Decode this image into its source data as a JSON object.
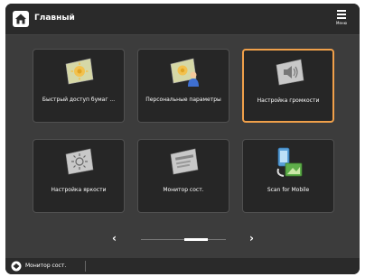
{
  "header": {
    "title": "Главный",
    "menu_label": "Меню"
  },
  "tiles": [
    {
      "label": "Быстрый доступ бумаг ...",
      "icon": "settings-sheet-icon"
    },
    {
      "label": "Персональные параметры",
      "icon": "personal-settings-icon"
    },
    {
      "label": "Настройка громкости",
      "icon": "volume-icon",
      "selected": true
    },
    {
      "label": "Настройка яркости",
      "icon": "brightness-icon"
    },
    {
      "label": "Монитор сост.",
      "icon": "status-monitor-icon"
    },
    {
      "label": "Scan for Mobile",
      "icon": "scan-for-mobile-icon"
    }
  ],
  "pager": {
    "prev": "‹",
    "next": "›"
  },
  "status_bar": {
    "label": "Монитор сост."
  },
  "colors": {
    "selected_border": "#f0a04a",
    "tile_bg": "#262626",
    "screen_bg": "#3c3c3c"
  }
}
